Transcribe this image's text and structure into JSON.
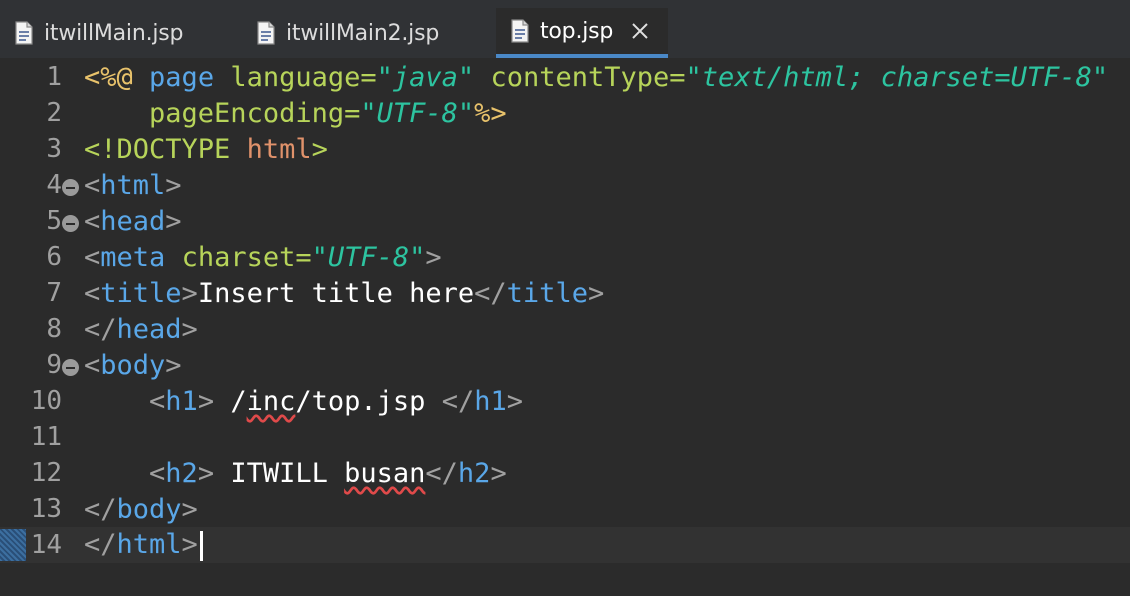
{
  "tabs": [
    {
      "label": "itwillMain.jsp",
      "active": false
    },
    {
      "label": "itwillMain2.jsp",
      "active": false
    },
    {
      "label": "top.jsp",
      "active": true
    }
  ],
  "lines": [
    {
      "num": "1"
    },
    {
      "num": "2"
    },
    {
      "num": "3"
    },
    {
      "num": "4"
    },
    {
      "num": "5"
    },
    {
      "num": "6"
    },
    {
      "num": "7"
    },
    {
      "num": "8"
    },
    {
      "num": "9"
    },
    {
      "num": "10"
    },
    {
      "num": "11"
    },
    {
      "num": "12"
    },
    {
      "num": "13"
    },
    {
      "num": "14"
    }
  ],
  "code": {
    "l1_open": "<%@",
    "l1_page": "page",
    "l1_lang_attr": "language=",
    "l1_lang_val": "\"java\"",
    "l1_ct_attr": "contentType=",
    "l1_ct_val": "\"text/html; charset=UTF-8\"",
    "l2_pe_attr": "pageEncoding=",
    "l2_pe_val": "\"UTF-8\"",
    "l2_close": "%>",
    "l3_doctype": "<!DOCTYPE",
    "l3_html": "html",
    "l3_close": ">",
    "l4_lt": "<",
    "l4_tag": "html",
    "l4_gt": ">",
    "l5_lt": "<",
    "l5_tag": "head",
    "l5_gt": ">",
    "l6_lt": "<",
    "l6_tag": "meta",
    "l6_attr": "charset=",
    "l6_val": "\"UTF-8\"",
    "l6_gt": ">",
    "l7_lt": "<",
    "l7_tag": "title",
    "l7_gt": ">",
    "l7_text": "Insert title here",
    "l7_clt": "</",
    "l7_ctag": "title",
    "l7_cgt": ">",
    "l8_lt": "</",
    "l8_tag": "head",
    "l8_gt": ">",
    "l9_lt": "<",
    "l9_tag": "body",
    "l9_gt": ">",
    "l10_lt": "<",
    "l10_tag": "h1",
    "l10_gt": ">",
    "l10_t1": " /",
    "l10_err": "inc",
    "l10_t2": "/top.jsp ",
    "l10_clt": "</",
    "l10_ctag": "h1",
    "l10_cgt": ">",
    "l12_lt": "<",
    "l12_tag": "h2",
    "l12_gt": ">",
    "l12_t1": " ITWILL ",
    "l12_err": "busan",
    "l12_clt": "</",
    "l12_ctag": "h2",
    "l12_cgt": ">",
    "l13_lt": "</",
    "l13_tag": "body",
    "l13_gt": ">",
    "l14_lt": "</",
    "l14_tag": "html",
    "l14_gt": ">"
  },
  "colors": {
    "background": "#2b2b2b",
    "tag": "#5aa7e8",
    "attribute": "#b7d45a",
    "string": "#2dc4a0",
    "directive": "#e8c26b",
    "active_tab_underline": "#4a88c7"
  },
  "icons": {
    "file": "jsp-file-icon",
    "close": "close-icon",
    "fold": "fold-collapse-icon"
  }
}
